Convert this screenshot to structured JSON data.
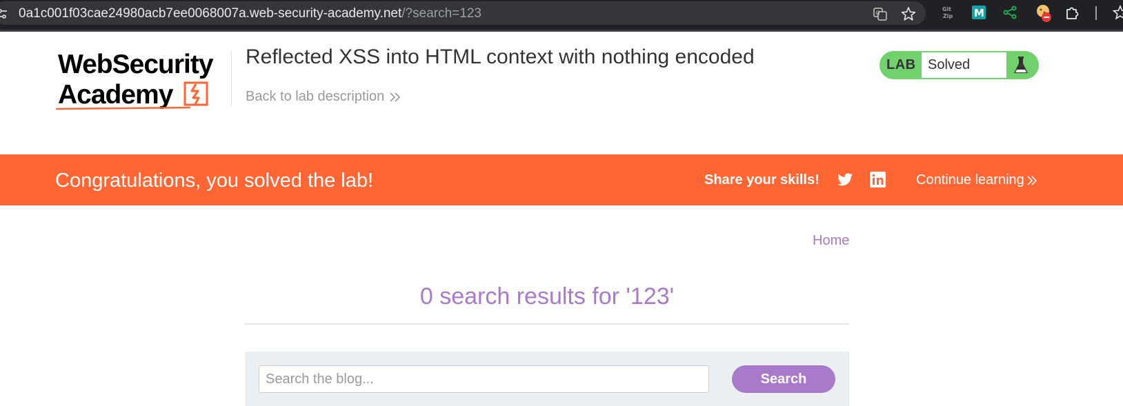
{
  "browser": {
    "url_host": "0a1c001f03cae24980acb7ee0068007a.web-security-academy.net",
    "url_path": "/?search=123"
  },
  "header": {
    "logo_alt": "Web Security Academy",
    "lab_title": "Reflected XSS into HTML context with nothing encoded",
    "back_link": "Back to lab description"
  },
  "lab_status": {
    "badge": "LAB",
    "status": "Solved"
  },
  "banner": {
    "message": "Congratulations, you solved the lab!",
    "share_label": "Share your skills!",
    "continue_label": "Continue learning"
  },
  "nav": {
    "home": "Home"
  },
  "search": {
    "results_heading": "0 search results for '123'",
    "placeholder": "Search the blog...",
    "button_label": "Search"
  },
  "colors": {
    "orange": "#ff6633",
    "purple": "#a97ac9",
    "green": "#70d16d"
  }
}
